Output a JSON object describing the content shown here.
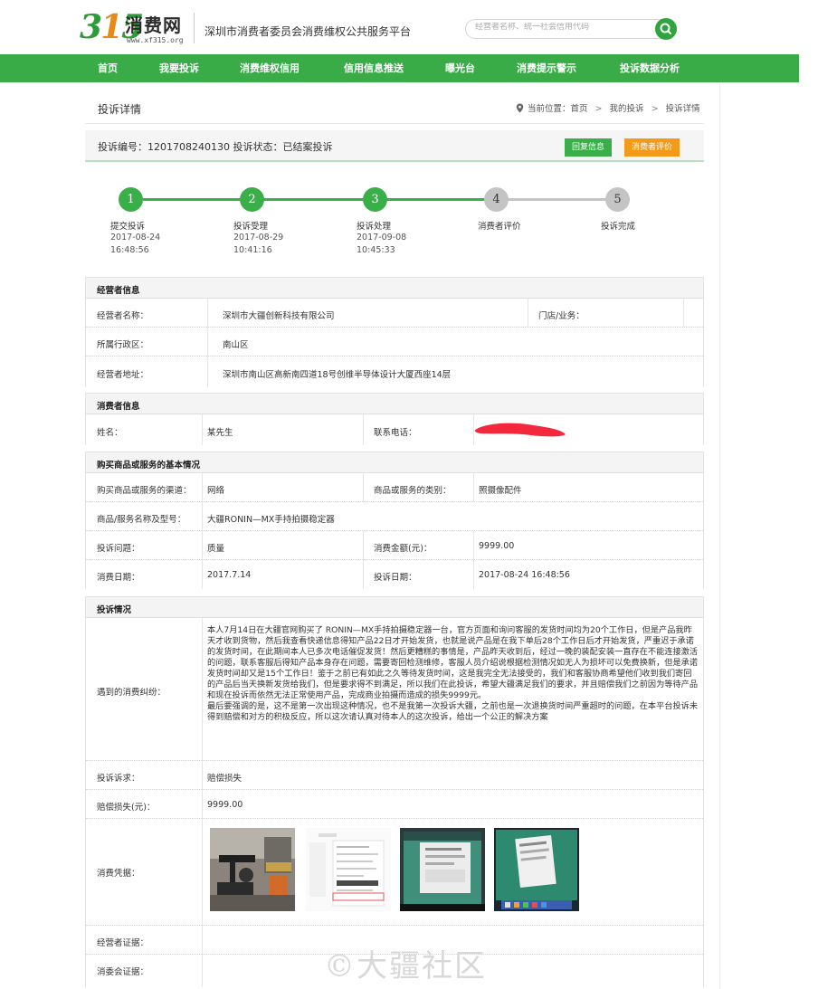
{
  "header": {
    "logo_text": "消费网",
    "logo_digits": [
      "3",
      "1",
      "5"
    ],
    "logo_url": "www.xf315.org",
    "subtitle": "深圳市消费者委员会消费维权公共服务平台",
    "search_placeholder": "经营者名称、统一社会信用代码"
  },
  "nav": {
    "items": [
      "首页",
      "我要投诉",
      "消费维权信用",
      "信用信息推送",
      "曝光台",
      "消费提示警示",
      "投诉数据分析"
    ]
  },
  "page": {
    "title": "投诉详情",
    "breadcrumb": [
      "当前位置：首页",
      ">",
      "我的投诉",
      ">",
      "投诉详情"
    ]
  },
  "status": {
    "text": "投诉编号：1201708240130 投诉状态：已结案投诉",
    "reply_label": "回复信息",
    "rate_label": "消费者评价"
  },
  "progress": {
    "steps": [
      {
        "num": "1",
        "label": "提交投诉",
        "date": "2017-08-24",
        "time": "16:48:56",
        "done": true
      },
      {
        "num": "2",
        "label": "投诉受理",
        "date": "2017-08-29",
        "time": "10:41:16",
        "done": true
      },
      {
        "num": "3",
        "label": "投诉处理",
        "date": "2017-09-08",
        "time": "10:45:33",
        "done": true
      },
      {
        "num": "4",
        "label": "消费者评价",
        "date": "",
        "time": "",
        "done": false
      },
      {
        "num": "5",
        "label": "投诉完成",
        "date": "",
        "time": "",
        "done": false
      }
    ],
    "colors": {
      "done": "#3aae48",
      "pending": "#bdbdbd"
    }
  },
  "business": {
    "heading": "经营者信息",
    "name_label": "经营者名称：",
    "name_value": "深圳市大疆创新科技有限公司",
    "store_label": "门店/业务：",
    "store_value": "",
    "district_label": "所属行政区：",
    "district_value": "南山区",
    "address_label": "经营者地址：",
    "address_value": "深圳市南山区高新南四道18号创维半导体设计大厦西座14层"
  },
  "consumer": {
    "heading": "消费者信息",
    "name_label": "姓名：",
    "name_value": "某先生",
    "phone_label": "联系电话："
  },
  "purchase": {
    "heading": "购买商品或服务的基本情况",
    "channel_label": "购买商品或服务的渠道：",
    "channel_value": "网络",
    "category_label": "商品或服务的类别：",
    "category_value": "照摄像配件",
    "model_label": "商品/服务名称及型号：",
    "model_value": "大疆RONIN—MX手持拍摄稳定器",
    "issue_label": "投诉问题：",
    "issue_value": "质量",
    "amount_label": "消费金额(元)：",
    "amount_value": "9999.00",
    "purchase_date_label": "消费日期：",
    "purchase_date_value": "2017.7.14",
    "complaint_date_label": "投诉日期：",
    "complaint_date_value": "2017-08-24 16:48:56"
  },
  "complaint": {
    "heading": "投诉情况",
    "dispute_label": "遇到的消费纠纷：",
    "dispute_text": "本人7月14日在大疆官网购买了 RONIN—MX手持拍摄稳定器一台，官方页面和询问客服的发货时间均为20个工作日，但是产品我昨天才收到货物，然后我查看快递信息得知产品22日才开始发货，也就是说产品是在我下单后28个工作日后才开始发货，严重迟于承诺的发货时间，在此期间本人已多次电话催促发货！然后更糟糕的事情是，产品昨天收到后，经过一晚的装配安装一直存在不能连接激活的问题，联系客服后得知产品本身存在问题，需要寄回检测维修，客服人员介绍说根据检测情况如无人为损坏可以免费换新，但是承诺发货时间却又是15个工作日！鉴于之前已有如此之久等待发货时间，这是我完全无法接受的，我们和客服协商希望他们收到我们寄回的产品后当天换新发货给我们，但是要求得不到满足，所以我们在此投诉，希望大疆满足我们的要求，并且赔偿我们之前因为等待产品和现在投诉而依然无法正常使用产品，完成商业拍摄而造成的损失9999元。",
    "dispute_text2": "最后要强调的是，这不是第一次出现这种情况，也不是我第一次投诉大疆，之前也是一次退换货时间严重超时的问题，在本平台投诉未得到赔偿和对方的积极反应，所以这次请认真对待本人的这次投诉，给出一个公正的解决方案",
    "demand_label": "投诉诉求：",
    "demand_value": "赔偿损失",
    "compensation_label": "赔偿损失(元)：",
    "compensation_value": "9999.00",
    "evidence_label": "消费凭据：",
    "business_evidence_label": "经营者证据：",
    "council_evidence_label": "消委会证据："
  },
  "watermark": "©大疆社区"
}
